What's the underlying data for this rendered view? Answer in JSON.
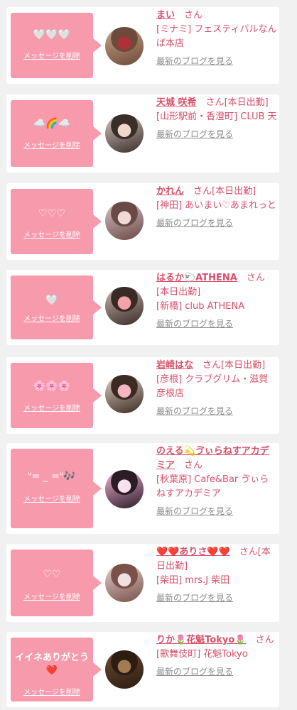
{
  "items": [
    {
      "message": "🤍🤍🤍",
      "message_sub": "",
      "delete_label": "メッセージを削除",
      "name": "まい",
      "san": "さん",
      "status": "",
      "location": "[ミナミ] フェスティバルなんば本店",
      "blog_label": "最新のブログを見る",
      "avatar_colors": [
        "#c9a48a",
        "#6d4a3a",
        "#b0303a"
      ]
    },
    {
      "message": "☁️🌈☁️",
      "message_sub": "",
      "delete_label": "メッセージを削除",
      "name": "天城 咲希",
      "san": "さん",
      "status": "[本日出勤]",
      "location": "[山形駅前・香澄町] CLUB 天",
      "blog_label": "最新のブログを見る",
      "avatar_colors": [
        "#d8c6bb",
        "#3a2e2b",
        "#f0d7cc"
      ]
    },
    {
      "message": "♡♡♡",
      "message_sub": "",
      "delete_label": "メッセージを削除",
      "name": "かれん",
      "san": "さん",
      "status": "[本日出勤]",
      "location": "[神田] あいまい♡あまれっと",
      "blog_label": "最新のブログを見る",
      "avatar_colors": [
        "#d7c4c7",
        "#6a4a45",
        "#f3d9d6"
      ]
    },
    {
      "message": "🤍",
      "message_sub": "",
      "delete_label": "メッセージを削除",
      "name": "はるか🐑ATHENA",
      "san": "さん",
      "status": "[本日出勤]",
      "location": "[新橋] club ATHENA",
      "blog_label": "最新のブログを見る",
      "avatar_colors": [
        "#c8b8ae",
        "#3a2a26",
        "#f2a3a8"
      ]
    },
    {
      "message": "🌸🌸🌸",
      "message_sub": "",
      "delete_label": "メッセージを削除",
      "name": "岩崎はな",
      "san": "さん",
      "status": "[本日出勤]",
      "location": "[彦根] クラブグリム・滋賀彦根店",
      "blog_label": "最新のブログを見る",
      "avatar_colors": [
        "#e0d2c6",
        "#3b2b22",
        "#f3b7c3"
      ]
    },
    {
      "message": "ᐡ= _ =ᐡ🎶",
      "message_sub": "",
      "delete_label": "メッセージを削除",
      "name": "のえる💫ゔぃらねすアカデミア",
      "san": "さん",
      "status": "",
      "location": "[秋葉原] Cafe&Bar ゔぃらねすアカデミア",
      "blog_label": "最新のブログを見る",
      "avatar_colors": [
        "#f6b3d8",
        "#2a1d26",
        "#f9e0ee"
      ]
    },
    {
      "message": "♡♡",
      "message_sub": "",
      "delete_label": "メッセージを削除",
      "name": "❤️❤️ありさ❤️❤️",
      "san": "さん",
      "status": "[本日出勤]",
      "location": "[柴田] mrs.J 柴田",
      "blog_label": "最新のブログを見る",
      "avatar_colors": [
        "#e4d3d1",
        "#7a5048",
        "#efe1df"
      ]
    },
    {
      "message": "イイネありがとう",
      "message_sub": "❤️",
      "delete_label": "メッセージを削除",
      "name": "りか🌷花魁Tokyo🌷",
      "san": "さん",
      "status": "",
      "location": "[歌舞伎町] 花魁Tokyo",
      "blog_label": "最新のブログを見る",
      "avatar_colors": [
        "#6b4a33",
        "#2c1c12",
        "#a47a52"
      ]
    }
  ]
}
